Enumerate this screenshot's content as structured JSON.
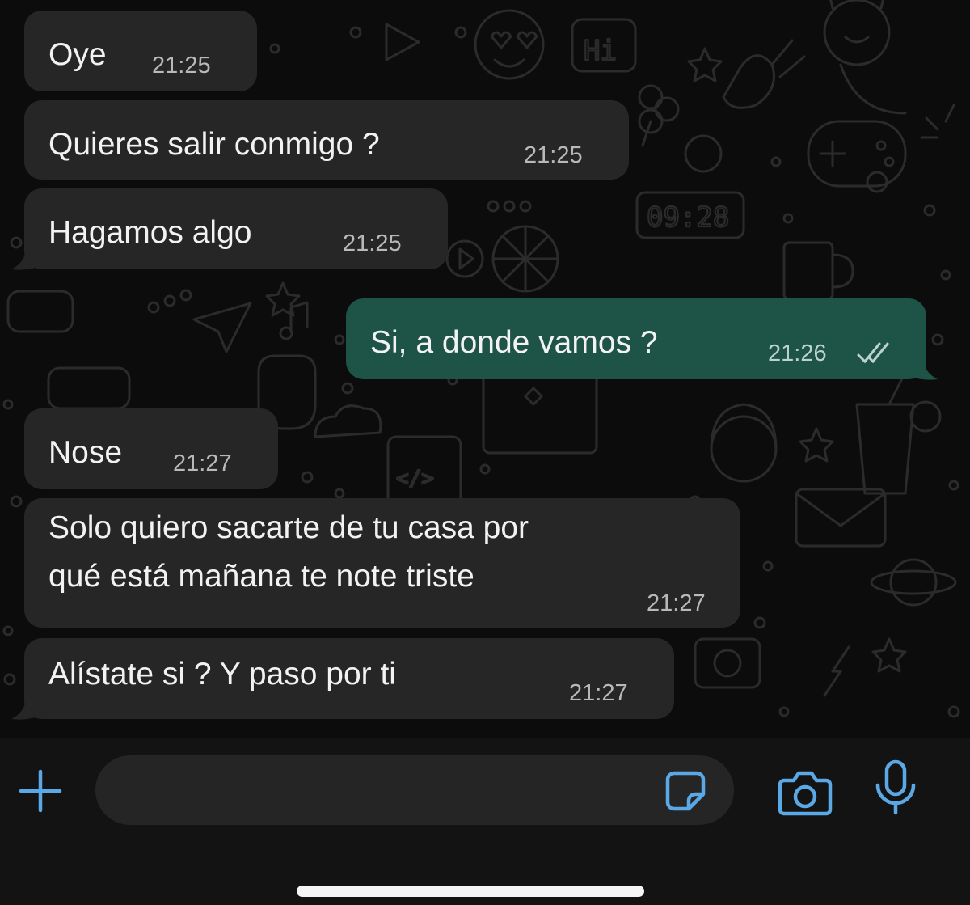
{
  "chat": {
    "messages": [
      {
        "direction": "incoming",
        "text": "Oye",
        "time": "21:25"
      },
      {
        "direction": "incoming",
        "text": "Quieres salir conmigo ?",
        "time": "21:25"
      },
      {
        "direction": "incoming",
        "text": "Hagamos algo",
        "time": "21:25"
      },
      {
        "direction": "outgoing",
        "text": "Si, a donde vamos ?",
        "time": "21:26",
        "status": "read"
      },
      {
        "direction": "incoming",
        "text": "Nose",
        "time": "21:27"
      },
      {
        "direction": "incoming",
        "text_lines": [
          "Solo quiero sacarte de tu casa por",
          "qué está mañana te note triste"
        ],
        "time": "21:27"
      },
      {
        "direction": "incoming",
        "text": "Alístate si ? Y paso por ti",
        "time": "21:27"
      }
    ],
    "wallpaper_labels": {
      "hi_sticker": "Hi",
      "clock_display": "09:28",
      "code_symbol": "</>"
    }
  },
  "input_bar": {
    "message_placeholder": "",
    "icons": [
      "plus-icon",
      "sticker-icon",
      "camera-icon",
      "microphone-icon"
    ]
  },
  "colors": {
    "incoming_bubble": "#262626",
    "outgoing_bubble": "#1e5447",
    "accent_icon": "#5aa8e6",
    "background": "#0c0c0c"
  }
}
